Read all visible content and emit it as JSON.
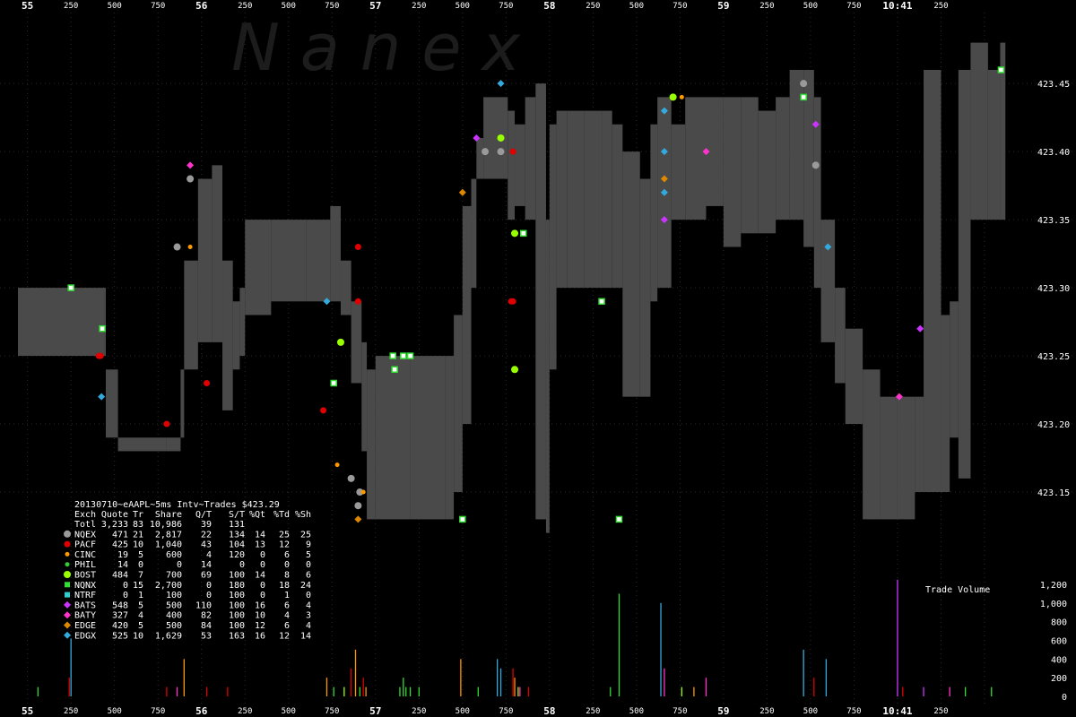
{
  "chart_data": {
    "type": "scatter",
    "watermark": "N a n e x",
    "legend": {
      "title": "20130710~eAAPL~5ms Intv~Trades $423.29",
      "header": [
        "Exch",
        "Quote",
        "Tr",
        "Share",
        "Q/T",
        "S/T",
        "%Qt",
        "%Td",
        "%Sh"
      ],
      "total": [
        "Totl",
        "3,233",
        "83",
        "10,986",
        "39",
        "131",
        "",
        "",
        ""
      ],
      "rows": [
        {
          "exch": "NQEX",
          "cells": [
            "471",
            "21",
            "2,817",
            "22",
            "134",
            "14",
            "25",
            "25"
          ],
          "color": "#9a9a9a",
          "marker": "circle-lg"
        },
        {
          "exch": "PACF",
          "cells": [
            "425",
            "10",
            "1,040",
            "43",
            "104",
            "13",
            "12",
            "9"
          ],
          "color": "#e00000",
          "marker": "circle"
        },
        {
          "exch": "CINC",
          "cells": [
            "19",
            "5",
            "600",
            "4",
            "120",
            "0",
            "6",
            "5"
          ],
          "color": "#ff9900",
          "marker": "dot"
        },
        {
          "exch": "PHIL",
          "cells": [
            "14",
            "0",
            "0",
            "14",
            "0",
            "0",
            "0",
            "0"
          ],
          "color": "#33cc33",
          "marker": "dot"
        },
        {
          "exch": "BOST",
          "cells": [
            "484",
            "7",
            "700",
            "69",
            "100",
            "14",
            "8",
            "6"
          ],
          "color": "#99ff00",
          "marker": "circle-lg"
        },
        {
          "exch": "NQNX",
          "cells": [
            "0",
            "15",
            "2,700",
            "0",
            "180",
            "0",
            "18",
            "24"
          ],
          "color": "#33dd33",
          "marker": "square"
        },
        {
          "exch": "NTRF",
          "cells": [
            "0",
            "1",
            "100",
            "0",
            "100",
            "0",
            "1",
            "0"
          ],
          "color": "#33cccc",
          "marker": "square"
        },
        {
          "exch": "BATS",
          "cells": [
            "548",
            "5",
            "500",
            "110",
            "100",
            "16",
            "6",
            "4"
          ],
          "color": "#cc33ff",
          "marker": "diamond"
        },
        {
          "exch": "BATY",
          "cells": [
            "327",
            "4",
            "400",
            "82",
            "100",
            "10",
            "4",
            "3"
          ],
          "color": "#ff33cc",
          "marker": "diamond"
        },
        {
          "exch": "EDGE",
          "cells": [
            "420",
            "5",
            "500",
            "84",
            "100",
            "12",
            "6",
            "4"
          ],
          "color": "#dd8800",
          "marker": "diamond"
        },
        {
          "exch": "EDGX",
          "cells": [
            "525",
            "10",
            "1,629",
            "53",
            "163",
            "16",
            "12",
            "14"
          ],
          "color": "#33aadd",
          "marker": "diamond"
        }
      ]
    },
    "x_axis": {
      "minute_labels": [
        {
          "label": "55",
          "t": 0
        },
        {
          "label": "56",
          "t": 1000
        },
        {
          "label": "57",
          "t": 2000
        },
        {
          "label": "58",
          "t": 3000
        },
        {
          "label": "59",
          "t": 4000
        },
        {
          "label": "10:41",
          "t": 5000
        }
      ],
      "sub_labels": [
        "250",
        "500",
        "750"
      ],
      "range_ms": [
        -55,
        5665
      ]
    },
    "y_axis": {
      "ticks": [
        "423.15",
        "423.20",
        "423.25",
        "423.30",
        "423.35",
        "423.40",
        "423.45"
      ],
      "range": [
        423.1,
        423.485
      ]
    },
    "volume_axis": {
      "title": "Trade Volume",
      "ticks": [
        "0",
        "200",
        "400",
        "600",
        "800",
        "1,000",
        "1,200"
      ],
      "range": [
        0,
        1200
      ]
    },
    "nbbo_band": [
      [
        -55,
        423.25,
        423.3
      ],
      [
        440,
        423.25,
        423.3
      ],
      [
        450,
        423.19,
        423.24
      ],
      [
        520,
        423.18,
        423.19
      ],
      [
        800,
        423.18,
        423.19
      ],
      [
        880,
        423.19,
        423.24
      ],
      [
        900,
        423.24,
        423.32
      ],
      [
        980,
        423.26,
        423.38
      ],
      [
        1060,
        423.26,
        423.39
      ],
      [
        1120,
        423.21,
        423.32
      ],
      [
        1180,
        423.24,
        423.29
      ],
      [
        1220,
        423.25,
        423.3
      ],
      [
        1250,
        423.28,
        423.35
      ],
      [
        1400,
        423.29,
        423.35
      ],
      [
        1600,
        423.29,
        423.35
      ],
      [
        1740,
        423.29,
        423.36
      ],
      [
        1800,
        423.28,
        423.32
      ],
      [
        1860,
        423.23,
        423.29
      ],
      [
        1920,
        423.18,
        423.26
      ],
      [
        1950,
        423.13,
        423.24
      ],
      [
        2000,
        423.13,
        423.25
      ],
      [
        2200,
        423.13,
        423.25
      ],
      [
        2400,
        423.13,
        423.25
      ],
      [
        2450,
        423.15,
        423.28
      ],
      [
        2500,
        423.2,
        423.36
      ],
      [
        2550,
        423.3,
        423.38
      ],
      [
        2580,
        423.38,
        423.41
      ],
      [
        2620,
        423.38,
        423.44
      ],
      [
        2720,
        423.38,
        423.44
      ],
      [
        2760,
        423.35,
        423.43
      ],
      [
        2800,
        423.36,
        423.42
      ],
      [
        2860,
        423.35,
        423.44
      ],
      [
        2920,
        423.13,
        423.45
      ],
      [
        2980,
        423.12,
        423.35
      ],
      [
        3000,
        423.24,
        423.42
      ],
      [
        3040,
        423.3,
        423.43
      ],
      [
        3100,
        423.3,
        423.43
      ],
      [
        3200,
        423.3,
        423.43
      ],
      [
        3300,
        423.3,
        423.43
      ],
      [
        3360,
        423.3,
        423.42
      ],
      [
        3420,
        423.22,
        423.4
      ],
      [
        3520,
        423.22,
        423.38
      ],
      [
        3580,
        423.29,
        423.42
      ],
      [
        3620,
        423.3,
        423.44
      ],
      [
        3700,
        423.35,
        423.42
      ],
      [
        3780,
        423.35,
        423.44
      ],
      [
        3900,
        423.36,
        423.44
      ],
      [
        4000,
        423.33,
        423.44
      ],
      [
        4100,
        423.34,
        423.44
      ],
      [
        4200,
        423.34,
        423.43
      ],
      [
        4300,
        423.35,
        423.44
      ],
      [
        4380,
        423.35,
        423.46
      ],
      [
        4460,
        423.33,
        423.46
      ],
      [
        4520,
        423.3,
        423.44
      ],
      [
        4560,
        423.26,
        423.35
      ],
      [
        4640,
        423.23,
        423.3
      ],
      [
        4700,
        423.2,
        423.27
      ],
      [
        4800,
        423.13,
        423.24
      ],
      [
        4900,
        423.13,
        423.22
      ],
      [
        5000,
        423.13,
        423.22
      ],
      [
        5080,
        423.13,
        423.22
      ],
      [
        5100,
        423.15,
        423.22
      ],
      [
        5150,
        423.15,
        423.46
      ],
      [
        5250,
        423.15,
        423.28
      ],
      [
        5300,
        423.19,
        423.29
      ],
      [
        5350,
        423.16,
        423.46
      ],
      [
        5420,
        423.35,
        423.48
      ],
      [
        5520,
        423.35,
        423.46
      ],
      [
        5590,
        423.35,
        423.48
      ],
      [
        5620,
        423.35,
        423.48
      ]
    ],
    "trades": [
      [
        250,
        423.3,
        "NQNX"
      ],
      [
        430,
        423.27,
        "NQNX"
      ],
      [
        420,
        423.25,
        "PACF"
      ],
      [
        410,
        423.25,
        "PACF"
      ],
      [
        425,
        423.22,
        "EDGX"
      ],
      [
        800,
        423.2,
        "PACF"
      ],
      [
        860,
        423.33,
        "NQEX"
      ],
      [
        935,
        423.33,
        "CINC"
      ],
      [
        935,
        423.38,
        "NQEX"
      ],
      [
        935,
        423.39,
        "BATY"
      ],
      [
        1030,
        423.23,
        "PACF"
      ],
      [
        1720,
        423.29,
        "EDGX"
      ],
      [
        1760,
        423.23,
        "NQNX"
      ],
      [
        1800,
        423.26,
        "BOST"
      ],
      [
        1700,
        423.21,
        "PACF"
      ],
      [
        1780,
        423.17,
        "CINC"
      ],
      [
        1860,
        423.16,
        "NQEX"
      ],
      [
        1910,
        423.15,
        "NQEX"
      ],
      [
        1930,
        423.15,
        "CINC"
      ],
      [
        1900,
        423.14,
        "NQEX"
      ],
      [
        1900,
        423.13,
        "EDGE"
      ],
      [
        1900,
        423.33,
        "PACF"
      ],
      [
        1900,
        423.29,
        "PACF"
      ],
      [
        2100,
        423.25,
        "NQNX"
      ],
      [
        2110,
        423.24,
        "NQNX"
      ],
      [
        2160,
        423.25,
        "NQNX"
      ],
      [
        2200,
        423.25,
        "NQNX"
      ],
      [
        2500,
        423.37,
        "EDGE"
      ],
      [
        2580,
        423.41,
        "BATS"
      ],
      [
        2630,
        423.4,
        "NQEX"
      ],
      [
        2720,
        423.41,
        "BOST"
      ],
      [
        2720,
        423.4,
        "NQEX"
      ],
      [
        2720,
        423.45,
        "EDGX"
      ],
      [
        2790,
        423.4,
        "PACF"
      ],
      [
        2800,
        423.34,
        "BOST"
      ],
      [
        2850,
        423.34,
        "NQNX"
      ],
      [
        2780,
        423.29,
        "PACF"
      ],
      [
        2790,
        423.29,
        "PACF"
      ],
      [
        2800,
        423.24,
        "BOST"
      ],
      [
        2500,
        423.13,
        "NQNX"
      ],
      [
        3400,
        423.13,
        "NQNX"
      ],
      [
        3300,
        423.29,
        "NQNX"
      ],
      [
        3660,
        423.43,
        "EDGX"
      ],
      [
        3710,
        423.44,
        "BOST"
      ],
      [
        3760,
        423.44,
        "CINC"
      ],
      [
        3660,
        423.4,
        "EDGX"
      ],
      [
        3660,
        423.38,
        "EDGE"
      ],
      [
        3660,
        423.37,
        "EDGX"
      ],
      [
        3660,
        423.35,
        "BATS"
      ],
      [
        3900,
        423.4,
        "BATY"
      ],
      [
        4460,
        423.45,
        "NQEX"
      ],
      [
        4460,
        423.44,
        "NQNX"
      ],
      [
        4530,
        423.42,
        "BATS"
      ],
      [
        4530,
        423.39,
        "NQEX"
      ],
      [
        4600,
        423.33,
        "EDGX"
      ],
      [
        5010,
        423.22,
        "BATY"
      ],
      [
        5130,
        423.27,
        "BATS"
      ],
      [
        5595,
        423.46,
        "NQNX"
      ]
    ],
    "volume_bars": [
      [
        60,
        100,
        "#33dd33"
      ],
      [
        250,
        620,
        "#33aadd"
      ],
      [
        240,
        200,
        "#e00000"
      ],
      [
        800,
        100,
        "#e00000"
      ],
      [
        860,
        100,
        "#ff33cc"
      ],
      [
        900,
        400,
        "#ff9900"
      ],
      [
        1030,
        100,
        "#e00000"
      ],
      [
        1150,
        100,
        "#e00000"
      ],
      [
        1720,
        200,
        "#ff9900"
      ],
      [
        1760,
        100,
        "#33dd33"
      ],
      [
        1820,
        100,
        "#99ff00"
      ],
      [
        1860,
        300,
        "#e00000"
      ],
      [
        1885,
        500,
        "#ff9900"
      ],
      [
        1910,
        100,
        "#33dd33"
      ],
      [
        1930,
        200,
        "#e00000"
      ],
      [
        1945,
        100,
        "#ff9900"
      ],
      [
        2140,
        100,
        "#33dd33"
      ],
      [
        2160,
        200,
        "#33dd33"
      ],
      [
        2175,
        100,
        "#33dd33"
      ],
      [
        2200,
        100,
        "#33dd33"
      ],
      [
        2250,
        100,
        "#33dd33"
      ],
      [
        2490,
        400,
        "#ff9900"
      ],
      [
        2590,
        100,
        "#33dd33"
      ],
      [
        2700,
        400,
        "#33aadd"
      ],
      [
        2720,
        300,
        "#33aadd"
      ],
      [
        2790,
        300,
        "#e00000"
      ],
      [
        2800,
        200,
        "#ff9900"
      ],
      [
        2820,
        100,
        "#99ff00"
      ],
      [
        2830,
        100,
        "#ff33cc"
      ],
      [
        2880,
        100,
        "#e00000"
      ],
      [
        3350,
        100,
        "#33dd33"
      ],
      [
        3400,
        1100,
        "#33dd33"
      ],
      [
        3640,
        1000,
        "#33aadd"
      ],
      [
        3660,
        300,
        "#ff33cc"
      ],
      [
        3760,
        100,
        "#99ff00"
      ],
      [
        3830,
        100,
        "#ff9900"
      ],
      [
        3900,
        200,
        "#ff33cc"
      ],
      [
        4460,
        500,
        "#33aadd"
      ],
      [
        4520,
        200,
        "#e00000"
      ],
      [
        4590,
        400,
        "#33aadd"
      ],
      [
        5000,
        1250,
        "#cc33ff"
      ],
      [
        5030,
        100,
        "#e00000"
      ],
      [
        5150,
        100,
        "#cc33ff"
      ],
      [
        5300,
        100,
        "#ff33cc"
      ],
      [
        5390,
        100,
        "#33dd33"
      ],
      [
        5540,
        100,
        "#33dd33"
      ]
    ]
  }
}
